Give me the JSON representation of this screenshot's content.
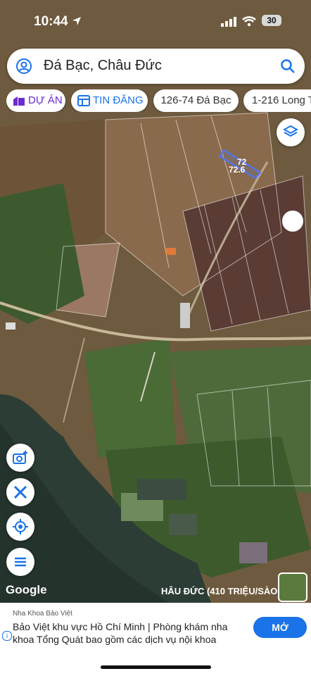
{
  "status": {
    "time": "10:44",
    "battery": "30"
  },
  "search": {
    "query": "Đá Bạc, Châu Đức"
  },
  "chips": [
    {
      "label": "DỰ ÁN"
    },
    {
      "label": "TIN ĐĂNG"
    },
    {
      "label": "126-74 Đá Bạc"
    },
    {
      "label": "1-216 Long T"
    }
  ],
  "measure": {
    "side_a": "72",
    "side_b": "72.6"
  },
  "map": {
    "attribution": "Google",
    "overlay_label": "HÂU ĐỨC (410 TRIỆU/SÀO"
  },
  "controls": [
    {
      "icon": "layers-icon"
    },
    {
      "icon": "camera-add-icon"
    },
    {
      "icon": "ruler-icon"
    },
    {
      "icon": "my-location-icon"
    },
    {
      "icon": "menu-icon"
    }
  ],
  "ad": {
    "sponsor": "Nha Khoa Bảo Việt",
    "text": "Bảo Việt khu vực Hồ Chí Minh | Phòng khám nha khoa Tổng Quát bao gồm các dịch vụ nội khoa",
    "cta": "MỞ"
  },
  "colors": {
    "accent": "#1a73e8",
    "purple": "#6b2bd0"
  }
}
